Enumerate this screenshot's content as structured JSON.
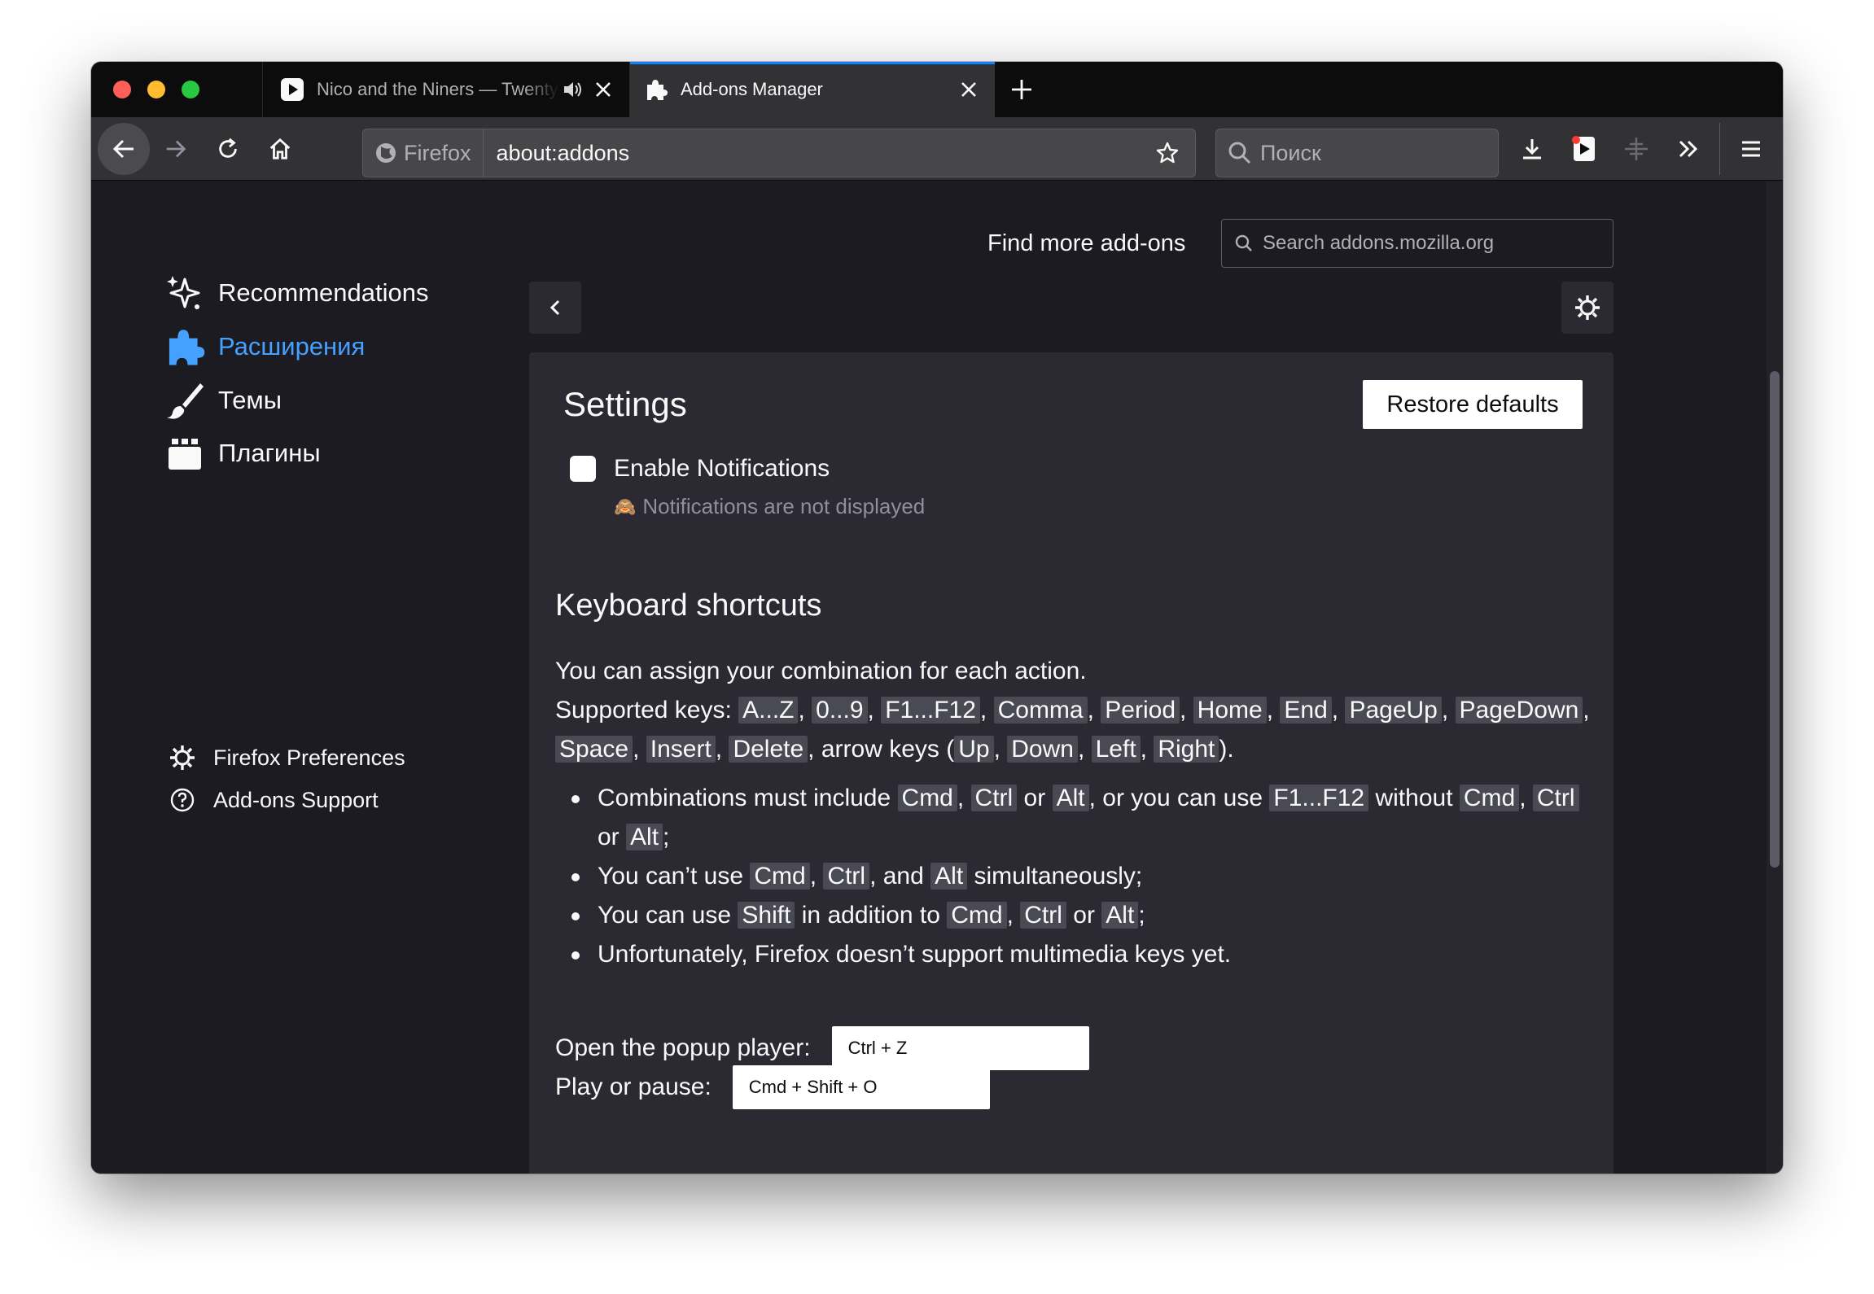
{
  "colors": {
    "accent": "#45a1ff",
    "tab_indicator": "#0a84ff",
    "close": "#ff5f57",
    "minimize": "#febc2e",
    "maximize": "#28c840"
  },
  "tabs": [
    {
      "title": "Nico and the Niners — Twenty One Pilots",
      "icon": "play-icon",
      "audio_icon": "speaker-icon",
      "active": false
    },
    {
      "title": "Add-ons Manager",
      "icon": "puzzle-icon",
      "active": true
    }
  ],
  "urlbar": {
    "identity": "Firefox",
    "url": "about:addons"
  },
  "searchbar": {
    "placeholder": "Поиск"
  },
  "header": {
    "find_more": "Find more add-ons",
    "search_placeholder": "Search addons.mozilla.org"
  },
  "sidebar": {
    "categories": [
      {
        "label": "Recommendations",
        "icon": "sparkle-icon"
      },
      {
        "label": "Расширения",
        "icon": "puzzle-icon",
        "selected": true
      },
      {
        "label": "Темы",
        "icon": "brush-icon"
      },
      {
        "label": "Плагины",
        "icon": "plugin-icon"
      }
    ],
    "footer": [
      {
        "label": "Firefox Preferences",
        "icon": "gear-icon"
      },
      {
        "label": "Add-ons Support",
        "icon": "help-icon"
      }
    ]
  },
  "settings": {
    "title": "Settings",
    "restore": "Restore defaults",
    "notifications_label": "Enable Notifications",
    "notifications_checked": false,
    "notifications_note": "Notifications are not displayed"
  },
  "keyboard": {
    "title": "Keyboard shortcuts",
    "intro": "You can assign your combination for each action.",
    "supported_prefix": "Supported keys:",
    "keys": [
      "A...Z",
      "0...9",
      "F1...F12",
      "Comma",
      "Period",
      "Home",
      "End",
      "PageUp",
      "PageDown",
      "Space",
      "Insert",
      "Delete"
    ],
    "arrow_text": "arrow keys (",
    "arrow_keys": [
      "Up",
      "Down",
      "Left",
      "Right"
    ],
    "rules": {
      "r1_a": "Combinations must include",
      "r1_b": "or",
      "r1_c": ", or you can use",
      "r1_d": "without",
      "r2_a": "You can’t use",
      "r2_b": ", and",
      "r2_c": "simultaneously;",
      "r3_a": "You can use",
      "r3_b": "in addition to",
      "r3_c": "or",
      "r4": "Unfortunately, Firefox doesn’t support multimedia keys yet."
    },
    "mods": {
      "cmd": "Cmd",
      "ctrl": "Ctrl",
      "alt": "Alt",
      "shift": "Shift",
      "fkeys": "F1...F12"
    },
    "shortcuts": [
      {
        "label": "Open the popup player:",
        "value": "Ctrl + Z"
      },
      {
        "label": "Play or pause:",
        "value": "Cmd + Shift + O"
      }
    ]
  }
}
